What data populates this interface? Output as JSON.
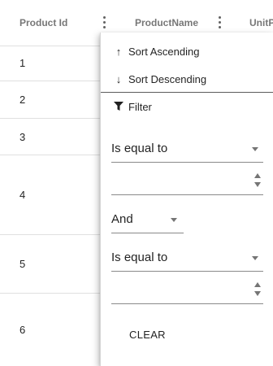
{
  "grid": {
    "columns": [
      {
        "label": "Product Id"
      },
      {
        "label": "ProductName"
      },
      {
        "label": "UnitP"
      }
    ],
    "rows": [
      {
        "id": "1"
      },
      {
        "id": "2"
      },
      {
        "id": "3"
      },
      {
        "id": "4"
      },
      {
        "id": "5"
      },
      {
        "id": "6"
      }
    ]
  },
  "column_menu": {
    "sort_ascending": "Sort Ascending",
    "sort_descending": "Sort Descending",
    "filter": "Filter",
    "icons": {
      "sort_ascending": "arrow-up-icon",
      "sort_descending": "arrow-down-icon",
      "filter": "filter-funnel-icon"
    },
    "filter_panel": {
      "operator1": "Is equal to",
      "value1": "",
      "logic": "And",
      "operator2": "Is equal to",
      "value2": "",
      "clear_label": "CLEAR"
    }
  }
}
